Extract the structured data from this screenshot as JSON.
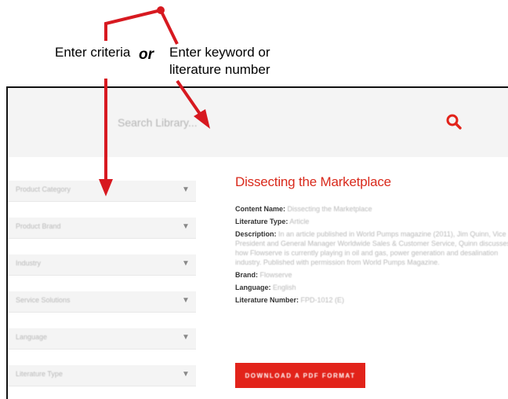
{
  "annotations": {
    "criteria": "Enter criteria",
    "or": "or",
    "keyword_line1": "Enter keyword or",
    "keyword_line2": "literature number"
  },
  "search": {
    "placeholder": "Search Library...",
    "icon": "search-icon",
    "accent": "#e2231a"
  },
  "filters": [
    {
      "label": "Product Category",
      "icon": "chevron-down-icon"
    },
    {
      "label": "Product Brand",
      "icon": "chevron-down-icon"
    },
    {
      "label": "Industry",
      "icon": "chevron-down-icon"
    },
    {
      "label": "Service Solutions",
      "icon": "chevron-down-icon"
    },
    {
      "label": "Language",
      "icon": "chevron-down-icon"
    },
    {
      "label": "Literature Type",
      "icon": "chevron-down-icon"
    }
  ],
  "result": {
    "title": "Dissecting the Marketplace",
    "title_color": "#d92a1c",
    "content_name_label": "Content Name:",
    "content_name": "Dissecting the Marketplace",
    "literature_type_label": "Literature Type:",
    "literature_type": "Article",
    "description_label": "Description:",
    "description": "In an article published in World Pumps magazine (2011), Jim Quinn, Vice President and General Manager Worldwide Sales & Customer Service, Quinn discusses how Flowserve is currently playing in oil and gas, power generation and desalination industry. Published with permission from World Pumps Magazine.",
    "brand_label": "Brand:",
    "brand": "Flowserve",
    "language_label": "Language:",
    "language": "English",
    "literature_number_label": "Literature Number:",
    "literature_number": "FPD-1012 (E)",
    "download_label": "DOWNLOAD A PDF FORMAT"
  }
}
